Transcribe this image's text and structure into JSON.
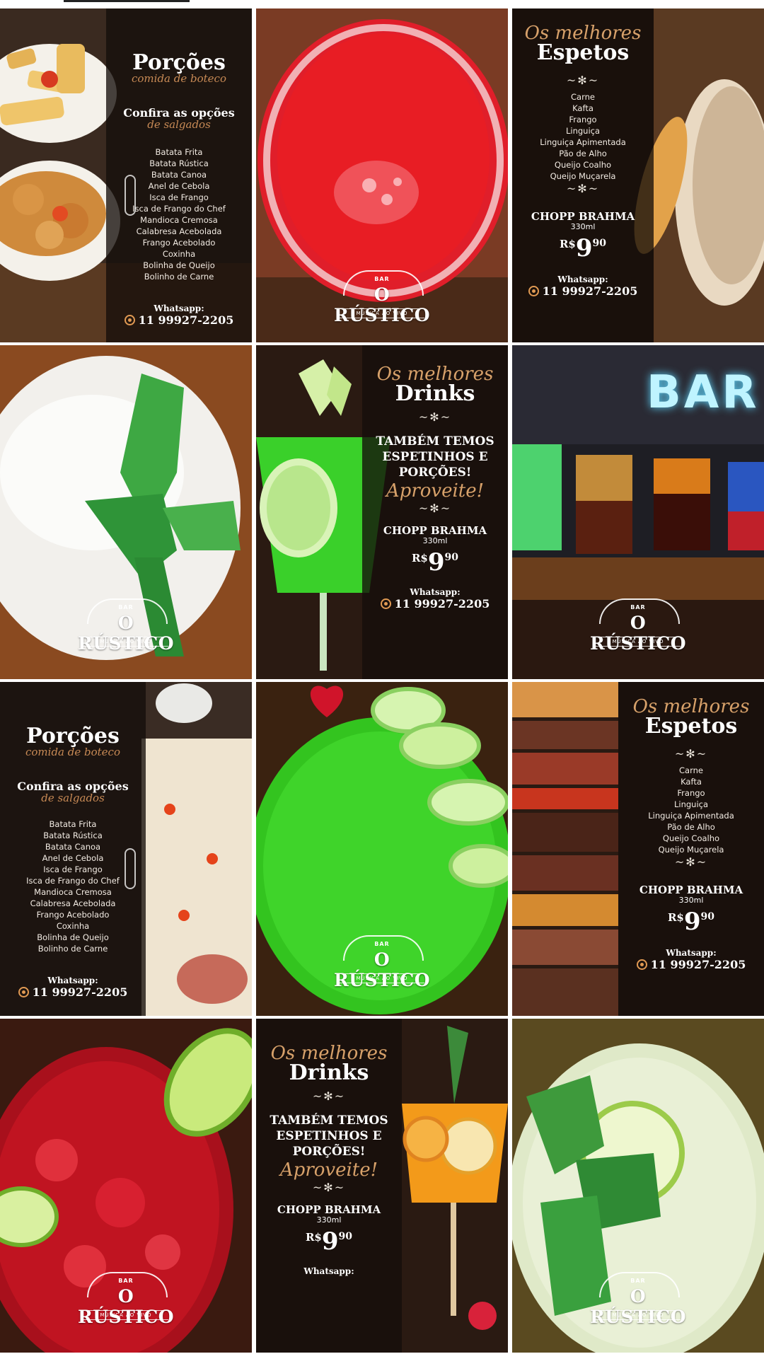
{
  "logo": {
    "bar": "BAR",
    "name": "O RÚSTICO",
    "tagline": "MÚSICA AO VIVO"
  },
  "porcoes": {
    "title": "Porções",
    "subtitle": "comida de boteco",
    "confira": "Confira as opções",
    "salgados": "de salgados",
    "items": [
      "Batata Frita",
      "Batata Rústica",
      "Batata Canoa",
      "Anel de Cebola",
      "Isca de Frango",
      "Isca de Frango do Chef",
      "Mandioca Cremosa",
      "Calabresa Acebolada",
      "Frango Acebolado",
      "Coxinha",
      "Bolinha de Queijo",
      "Bolinho de Carne"
    ]
  },
  "espetos": {
    "script": "Os melhores",
    "title": "Espetos",
    "items": [
      "Carne",
      "Kafta",
      "Frango",
      "Linguiça",
      "Linguiça Apimentada",
      "Pão de Alho",
      "Queijo Coalho",
      "Queijo Muçarela"
    ]
  },
  "drinks": {
    "script": "Os melhores",
    "title": "Drinks",
    "promo_lines": [
      "TAMBÉM TEMOS",
      "ESPETINHOS E",
      "PORÇÕES!"
    ],
    "aproveite": "Aproveite!"
  },
  "chopp": {
    "name": "CHOPP BRAHMA",
    "volume": "330ml",
    "currency": "R$",
    "price": "9",
    "cents": "90"
  },
  "whatsapp": {
    "label": "Whatsapp:",
    "number": "11 99927-2205"
  },
  "bar_sign": "BAR",
  "colors": {
    "accent": "#d7a16a",
    "panel": "#140e0a",
    "red_drink": "#d81a22",
    "green_drink": "#34c21e"
  }
}
